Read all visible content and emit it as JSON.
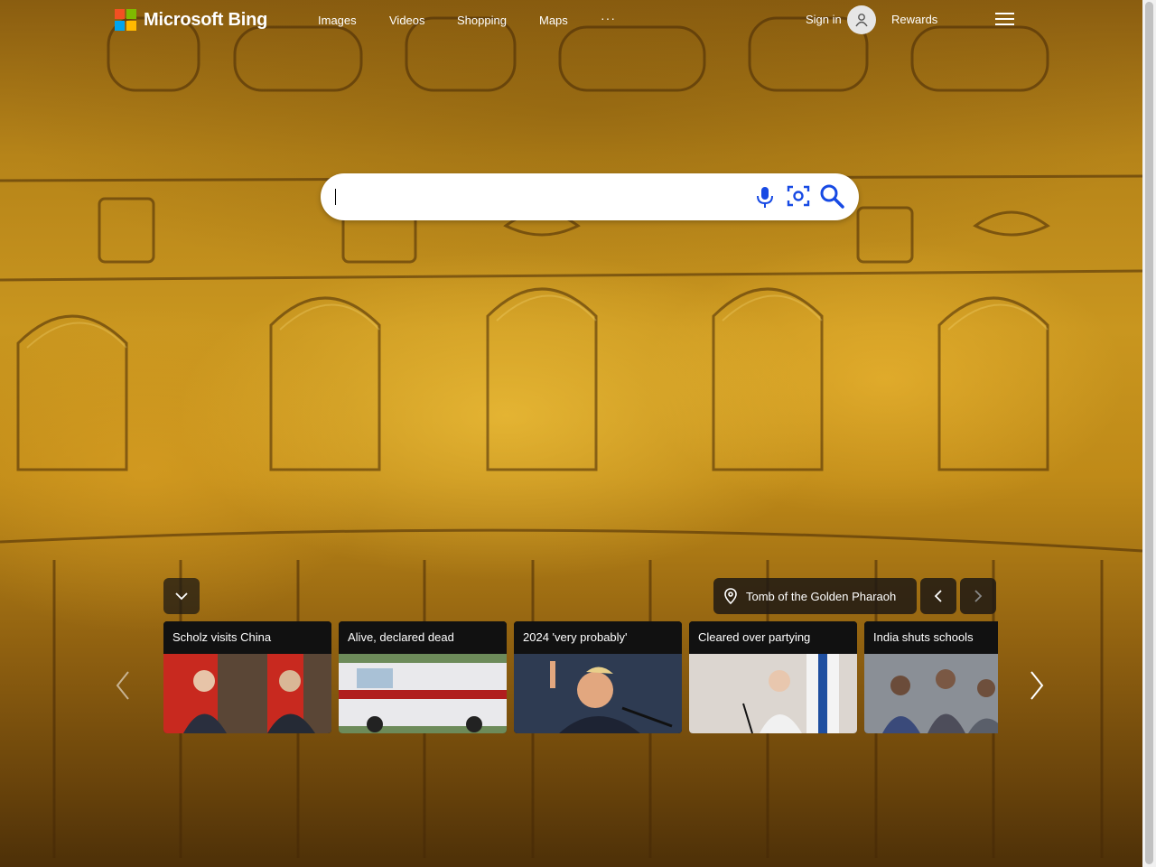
{
  "brand": {
    "name": "Microsoft Bing",
    "logo_colors": [
      "#f25022",
      "#7fba00",
      "#00a4ef",
      "#ffb900"
    ]
  },
  "nav": [
    {
      "label": "Images"
    },
    {
      "label": "Videos"
    },
    {
      "label": "Shopping"
    },
    {
      "label": "Maps"
    }
  ],
  "nav_more": "···",
  "account": {
    "signin_label": "Sign in",
    "rewards_label": "Rewards"
  },
  "search": {
    "value": "",
    "placeholder": ""
  },
  "icons": {
    "mic": "microphone-icon",
    "visual": "visual-search-icon",
    "search": "search-icon",
    "location": "location-pin-icon",
    "collapse": "chevron-down-icon",
    "prev": "chevron-left-icon",
    "next": "chevron-right-icon",
    "menu": "hamburger-icon",
    "avatar": "user-icon"
  },
  "image_of_day": {
    "title": "Tomb of the Golden Pharaoh"
  },
  "news": [
    {
      "title": "Scholz visits China"
    },
    {
      "title": "Alive, declared dead"
    },
    {
      "title": "2024 'very probably'"
    },
    {
      "title": "Cleared over partying"
    },
    {
      "title": "India shuts schools"
    }
  ],
  "colors": {
    "search_icon": "#174ae4",
    "background_gold": "#c9961f"
  }
}
